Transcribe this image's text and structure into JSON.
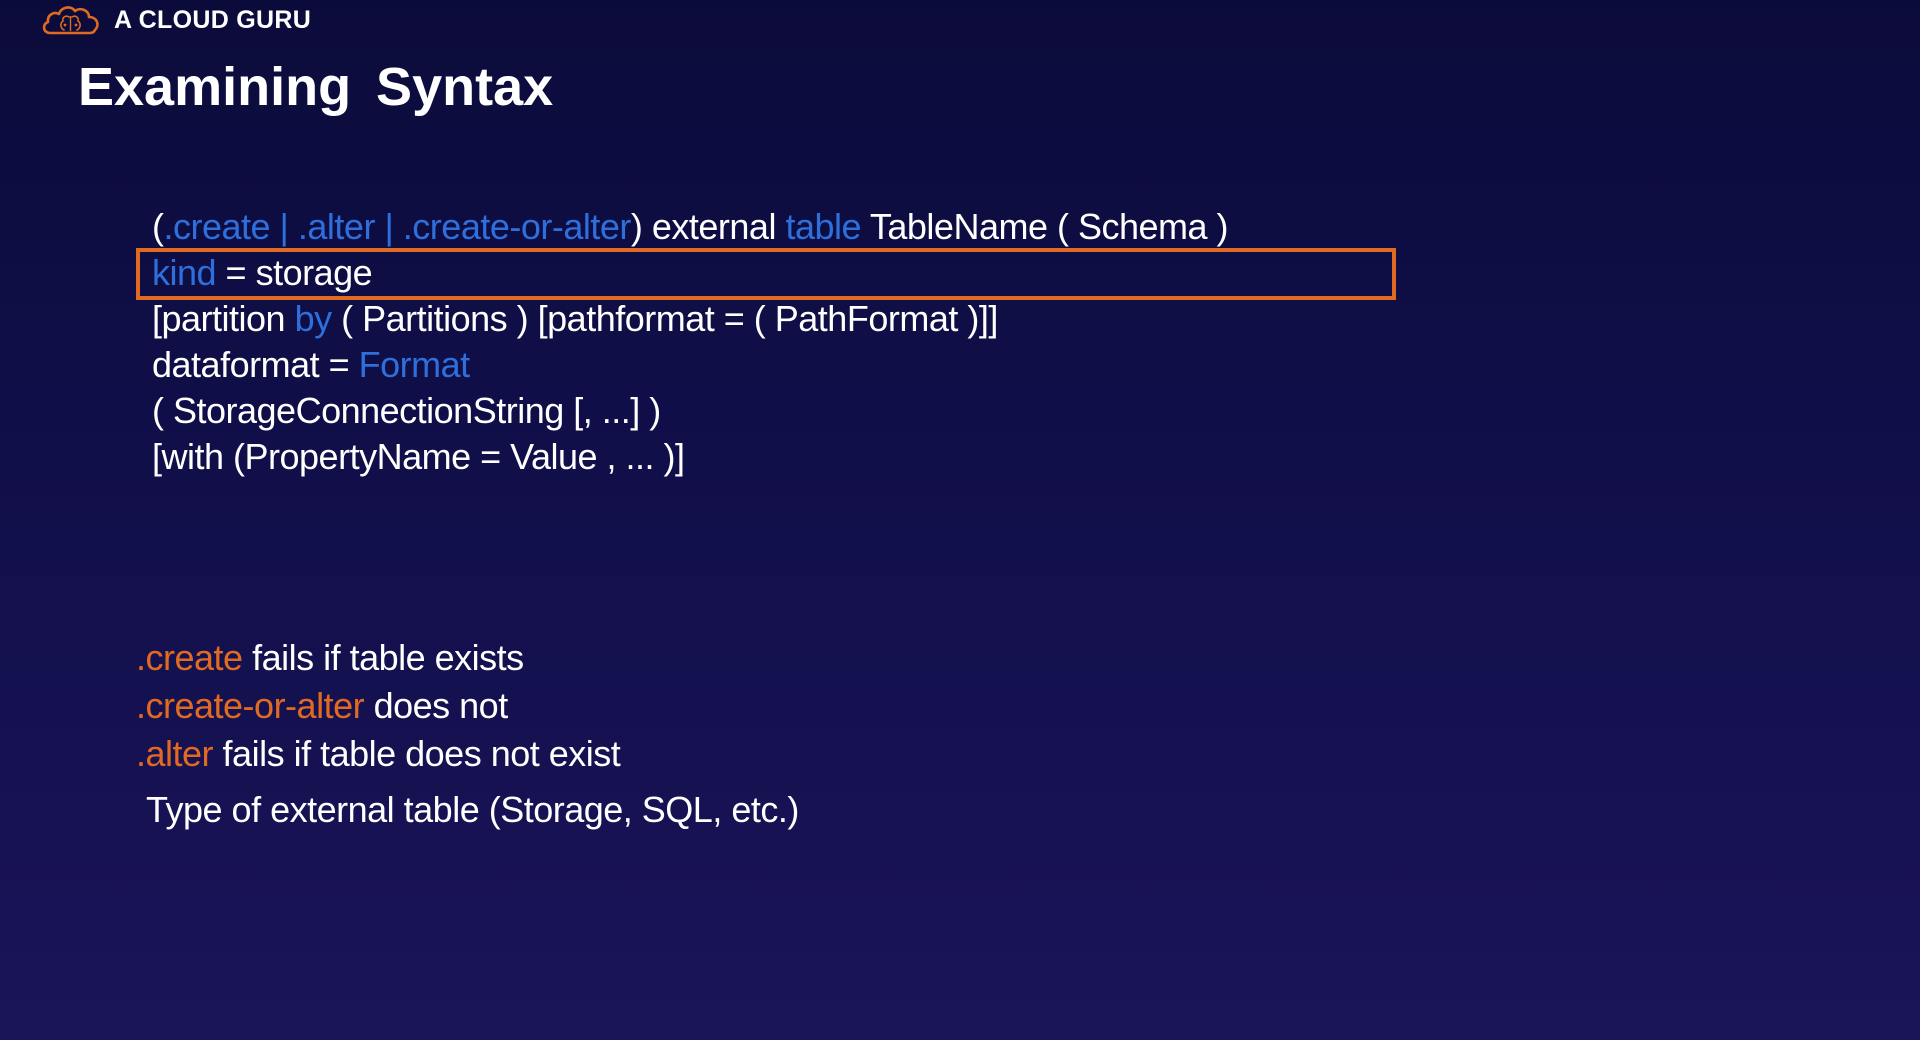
{
  "brand": {
    "name": "A CLOUD GURU",
    "accent_color": "#e06a22",
    "logo_icon": "cloud-brain-icon"
  },
  "slide": {
    "title": "Examining  Syntax"
  },
  "code": {
    "keyword_color": "#2f6fdb",
    "lines": [
      [
        {
          "t": "(",
          "kw": false
        },
        {
          "t": ".create | .alter | .create-or-alter",
          "kw": true
        },
        {
          "t": ") external ",
          "kw": false
        },
        {
          "t": "table",
          "kw": true
        },
        {
          "t": " TableName ( Schema )",
          "kw": false
        }
      ],
      [
        {
          "t": "kind",
          "kw": true
        },
        {
          "t": " = storage",
          "kw": false
        }
      ],
      [
        {
          "t": "[partition ",
          "kw": false
        },
        {
          "t": "by",
          "kw": true
        },
        {
          "t": " ( Partitions ) [pathformat = ( PathFormat )]]",
          "kw": false
        }
      ],
      [
        {
          "t": "dataformat = ",
          "kw": false
        },
        {
          "t": "Format",
          "kw": true
        }
      ],
      [
        {
          "t": "( StorageConnectionString [, ...] )",
          "kw": false
        }
      ],
      [
        {
          "t": "[with (PropertyName = Value , ... )]",
          "kw": false
        }
      ]
    ],
    "highlighted_line": 1
  },
  "notes": [
    {
      "accent": ".create",
      "rest": " fails if table exists"
    },
    {
      "accent": ".create-or-alter",
      "rest": " does not"
    },
    {
      "accent": ".alter",
      "rest": " fails if table does not exist"
    }
  ],
  "type_note": "Type of external table (Storage, SQL, etc.)"
}
